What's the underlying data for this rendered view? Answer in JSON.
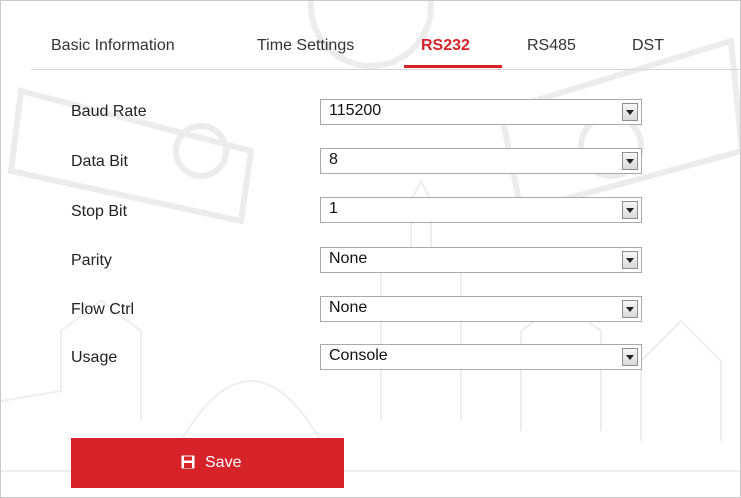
{
  "tabs": [
    {
      "label": "Basic Information",
      "active": false
    },
    {
      "label": "Time Settings",
      "active": false
    },
    {
      "label": "RS232",
      "active": true
    },
    {
      "label": "RS485",
      "active": false
    },
    {
      "label": "DST",
      "active": false
    }
  ],
  "fields": [
    {
      "label": "Baud Rate",
      "value": "115200"
    },
    {
      "label": "Data Bit",
      "value": "8"
    },
    {
      "label": "Stop Bit",
      "value": "1"
    },
    {
      "label": "Parity",
      "value": "None"
    },
    {
      "label": "Flow Ctrl",
      "value": "None"
    },
    {
      "label": "Usage",
      "value": "Console"
    }
  ],
  "save": {
    "label": "Save",
    "icon": "floppy-disk-icon"
  },
  "colors": {
    "accent": "#d6232a",
    "watermark": "#f0f0f0"
  }
}
